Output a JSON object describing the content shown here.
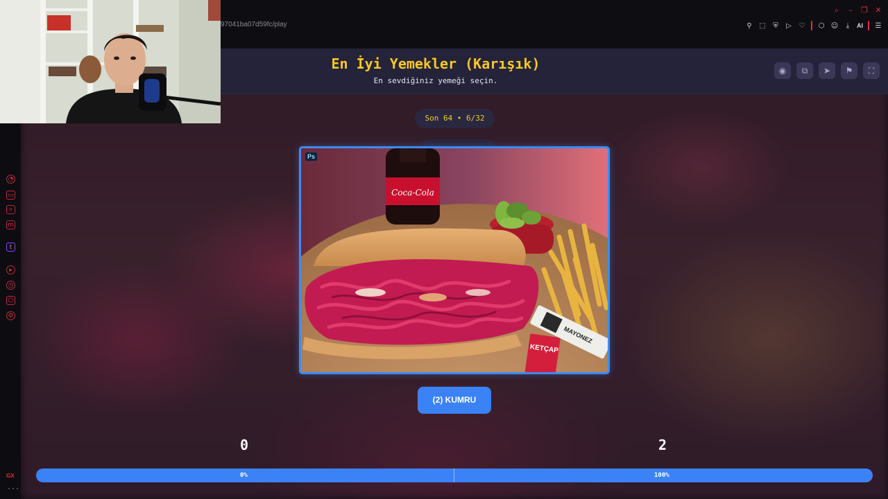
{
  "browser": {
    "url": "97041ba07d59fc/play",
    "window_controls": [
      "search-icon",
      "minimize-icon",
      "restore-icon",
      "close-icon"
    ],
    "extensions": [
      "pin-icon",
      "screenshot-icon",
      "shield-icon",
      "play-icon",
      "heart-icon",
      "cube-icon",
      "user-icon",
      "download-icon"
    ],
    "ai_label": "AI",
    "menu_icon": "menu-icon"
  },
  "sidebar": {
    "icons": [
      "speed-dial-icon",
      "bag-icon",
      "pocket-icon",
      "messenger-icon",
      "twitch-icon",
      "player-icon",
      "history-icon",
      "extensions-icon",
      "settings-icon"
    ],
    "gx_label": "GX",
    "more_label": "···"
  },
  "header": {
    "title": "En İyi Yemekler (Karışık)",
    "subtitle": "En sevdiğiniz yemeği seçin.",
    "buttons": [
      "eye-icon",
      "share-icon",
      "send-icon",
      "flag-icon",
      "fullscreen-icon"
    ]
  },
  "round": {
    "label": "Son 64 • 6/32"
  },
  "photo": {
    "badge": "Ps",
    "bottle_label": "Coca-Cola",
    "ketchup_label": "KETÇAP",
    "packet_label": "MAYONEZ"
  },
  "choice": {
    "button_label": "(2) KUMRU"
  },
  "scores": {
    "left": "0",
    "right": "2"
  },
  "progress": {
    "left_label": "0%",
    "right_label": "100%",
    "left_fraction": 0,
    "right_fraction": 1
  },
  "colors": {
    "accent": "#3b82f6",
    "title": "#f6c928",
    "browser_accent": "#e0303c"
  }
}
